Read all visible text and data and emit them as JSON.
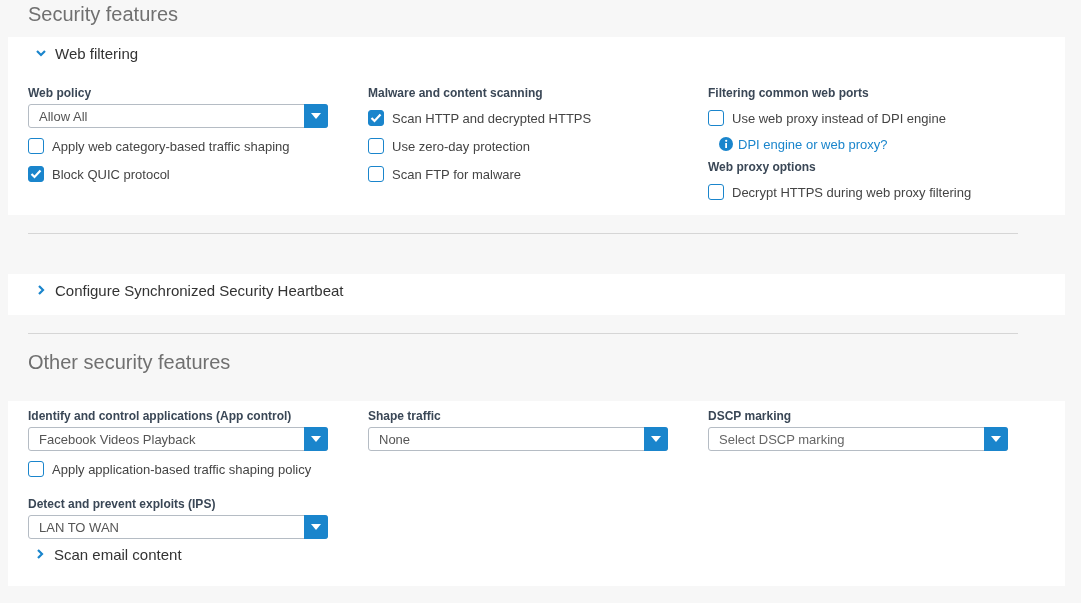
{
  "security_title": "Security features",
  "web_filtering": {
    "label": "Web filtering",
    "expanded": true,
    "columns": [
      [
        {
          "kind": "heading",
          "text": "Web policy"
        },
        {
          "kind": "select",
          "value": "Allow All"
        },
        {
          "kind": "checkbox",
          "label": "Apply web category-based traffic shaping",
          "checked": false
        },
        {
          "kind": "checkbox",
          "label": "Block QUIC protocol",
          "checked": true
        }
      ],
      [
        {
          "kind": "heading",
          "text": "Malware and content scanning"
        },
        {
          "kind": "checkbox",
          "label": "Scan HTTP and decrypted HTTPS",
          "checked": true
        },
        {
          "kind": "checkbox",
          "label": "Use zero-day protection",
          "checked": false
        },
        {
          "kind": "checkbox",
          "label": "Scan FTP for malware",
          "checked": false
        }
      ],
      [
        {
          "kind": "heading",
          "text": "Filtering common web ports"
        },
        {
          "kind": "checkbox",
          "label": "Use web proxy instead of DPI engine",
          "checked": false
        },
        {
          "kind": "link",
          "text": "DPI engine or web proxy?"
        },
        {
          "kind": "heading",
          "text": "Web proxy options"
        },
        {
          "kind": "checkbox",
          "label": "Decrypt HTTPS during web proxy filtering",
          "checked": false
        }
      ]
    ]
  },
  "heartbeat": {
    "label": "Configure Synchronized Security Heartbeat",
    "expanded": false
  },
  "other_title": "Other security features",
  "other_features": {
    "columns": [
      [
        {
          "kind": "heading",
          "text": "Identify and control applications (App control)"
        },
        {
          "kind": "select",
          "value": "Facebook Videos Playback"
        },
        {
          "kind": "checkbox",
          "label": "Apply application-based traffic shaping policy",
          "checked": false
        },
        {
          "kind": "heading",
          "text": "Detect and prevent exploits (IPS)"
        },
        {
          "kind": "select",
          "value": "LAN TO WAN"
        }
      ],
      [
        {
          "kind": "heading",
          "text": "Shape traffic"
        },
        {
          "kind": "select",
          "value": "None"
        }
      ],
      [
        {
          "kind": "heading",
          "text": "DSCP marking"
        },
        {
          "kind": "select",
          "placeholder": "Select DSCP marking"
        }
      ]
    ]
  },
  "scan_email": {
    "label": "Scan email content",
    "expanded": false
  }
}
